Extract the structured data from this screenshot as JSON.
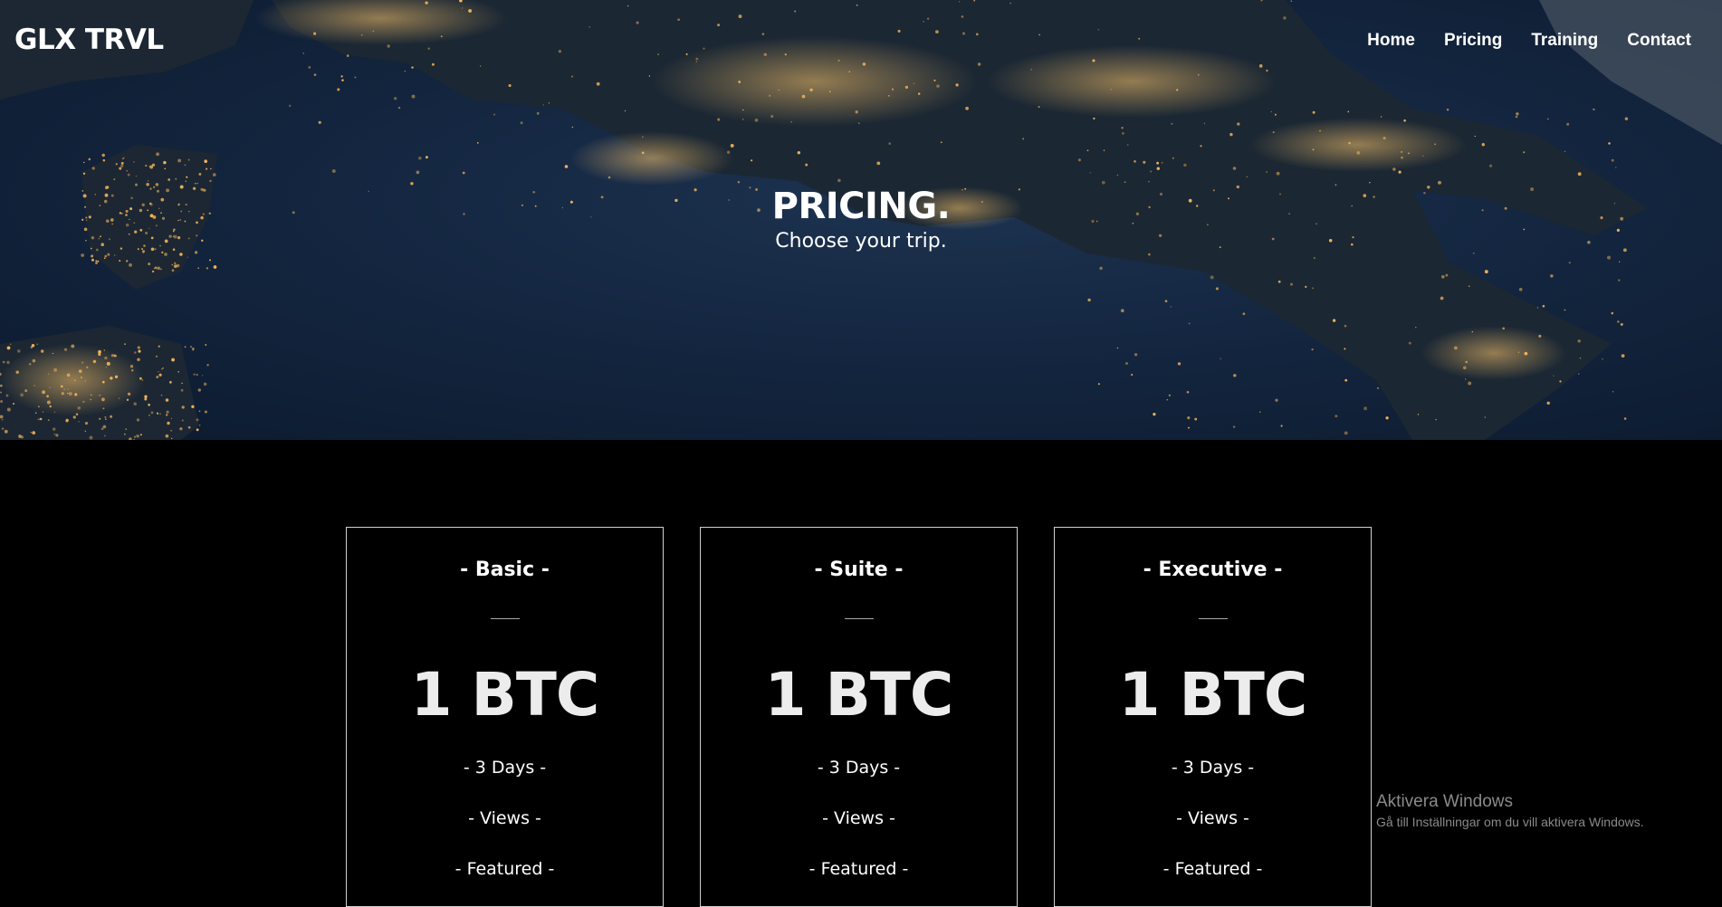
{
  "header": {
    "logo": "GLX TRVL",
    "nav": [
      "Home",
      "Pricing",
      "Training",
      "Contact"
    ]
  },
  "hero": {
    "title": "PRICING.",
    "subtitle": "Choose your trip."
  },
  "plans": [
    {
      "name": "- Basic -",
      "price": "1 BTC",
      "features": [
        "- 3 Days -",
        "- Views -",
        "- Featured -"
      ]
    },
    {
      "name": "- Suite -",
      "price": "1 BTC",
      "features": [
        "- 3 Days -",
        "- Views -",
        "- Featured -"
      ]
    },
    {
      "name": "- Executive -",
      "price": "1 BTC",
      "features": [
        "- 3 Days -",
        "- Views -",
        "- Featured -"
      ]
    }
  ],
  "watermark": {
    "title": "Aktivera Windows",
    "subtitle": "Gå till Inställningar om du vill aktivera Windows."
  },
  "colors": {
    "page_background": "#000000",
    "hero_ocean": "#142640",
    "city_lights": "#f3b55a",
    "card_border": "#d0d0d0"
  }
}
